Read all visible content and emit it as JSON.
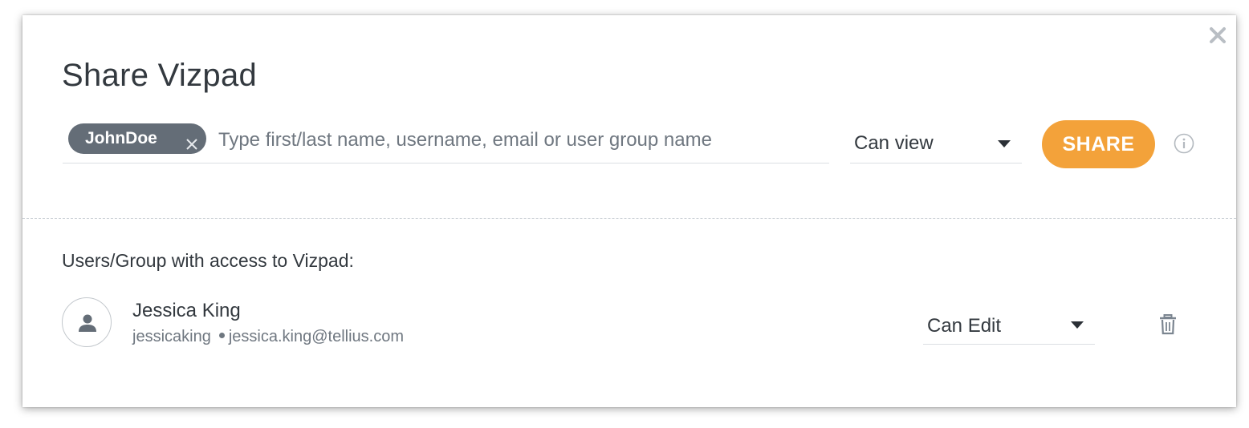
{
  "dialog": {
    "title": "Share Vizpad",
    "close_icon": "close-icon"
  },
  "share": {
    "chips": [
      {
        "label": "JohnDoe",
        "remove_icon": "close-icon"
      }
    ],
    "input_placeholder": "Type first/last name, username, email or user group name",
    "input_value": "",
    "permission_selected": "Can view",
    "share_button_label": "SHARE",
    "info_icon": "info-icon"
  },
  "access": {
    "heading": "Users/Group with access to Vizpad:",
    "users": [
      {
        "name": "Jessica King",
        "username": "jessicaking",
        "email": "jessica.king@tellius.com",
        "permission": "Can Edit",
        "avatar_icon": "user-icon",
        "delete_icon": "trash-icon"
      }
    ]
  },
  "colors": {
    "accent": "#f3a23a",
    "chip": "#646d77",
    "text": "#33393f",
    "muted": "#6f7780"
  }
}
